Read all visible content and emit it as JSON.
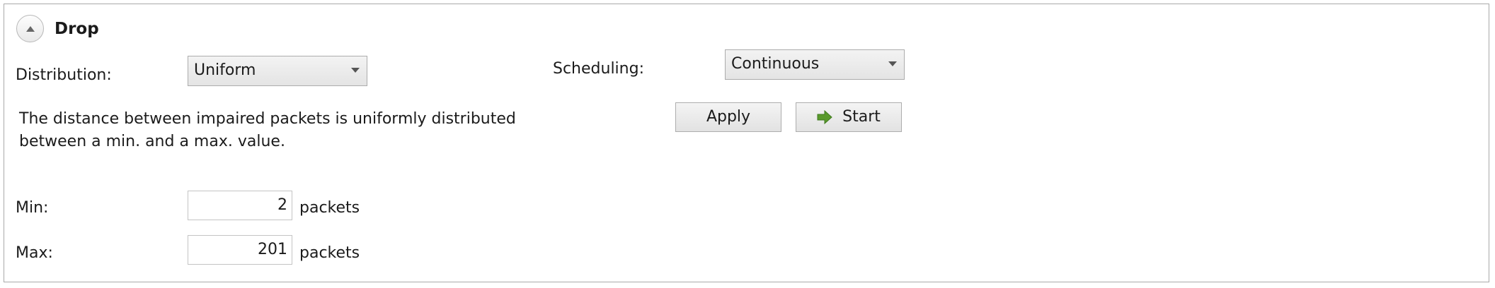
{
  "section": {
    "title": "Drop",
    "collapse_icon": "chevron-up-icon"
  },
  "distribution": {
    "label": "Distribution:",
    "selected": "Uniform",
    "description_line1": "The distance between impaired packets is uniformly distributed",
    "description_line2": "between a min. and a max. value."
  },
  "scheduling": {
    "label": "Scheduling:",
    "selected": "Continuous"
  },
  "buttons": {
    "apply_label": "Apply",
    "start_label": "Start",
    "start_icon": "arrow-right-icon",
    "start_icon_color": "#5a9a2c"
  },
  "min": {
    "label": "Min:",
    "value": "2",
    "unit": "packets"
  },
  "max": {
    "label": "Max:",
    "value": "201",
    "unit": "packets"
  }
}
